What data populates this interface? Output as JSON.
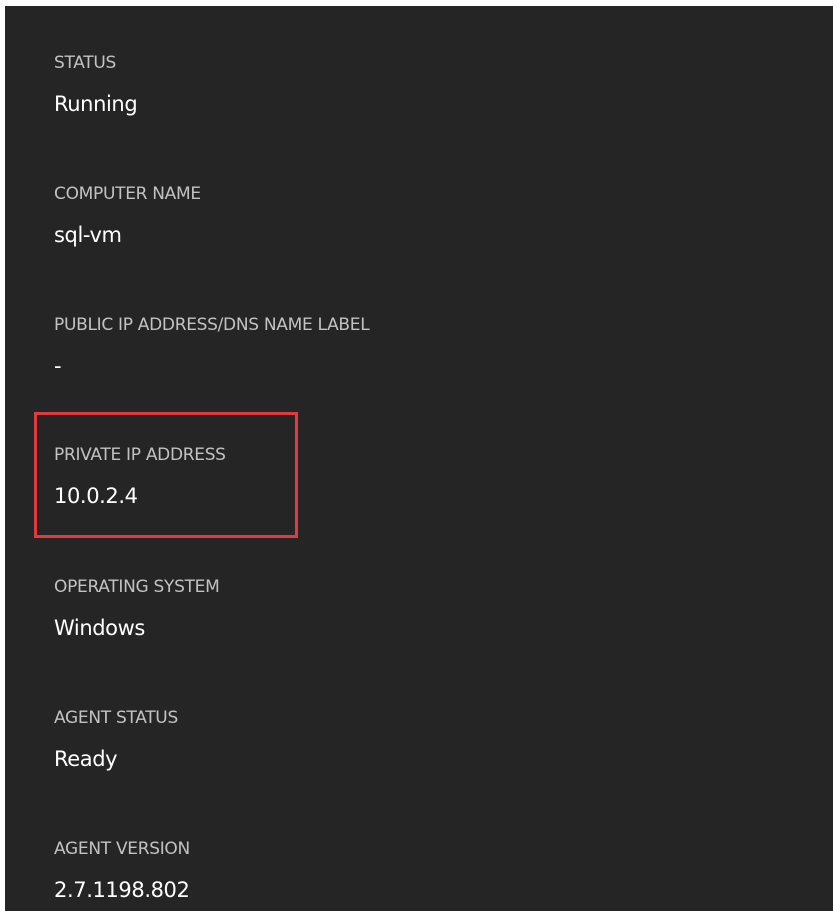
{
  "colors": {
    "panel_background": "#252525",
    "label": "#c2c2c2",
    "value": "#ffffff",
    "highlight": "#e0393e"
  },
  "properties": [
    {
      "label": "STATUS",
      "value": "Running"
    },
    {
      "label": "COMPUTER NAME",
      "value": "sql-vm"
    },
    {
      "label": "PUBLIC IP ADDRESS/DNS NAME LABEL",
      "value": "-"
    },
    {
      "label": "PRIVATE IP ADDRESS",
      "value": "10.0.2.4"
    },
    {
      "label": "OPERATING SYSTEM",
      "value": "Windows"
    },
    {
      "label": "AGENT STATUS",
      "value": "Ready"
    },
    {
      "label": "AGENT VERSION",
      "value": "2.7.1198.802"
    }
  ]
}
